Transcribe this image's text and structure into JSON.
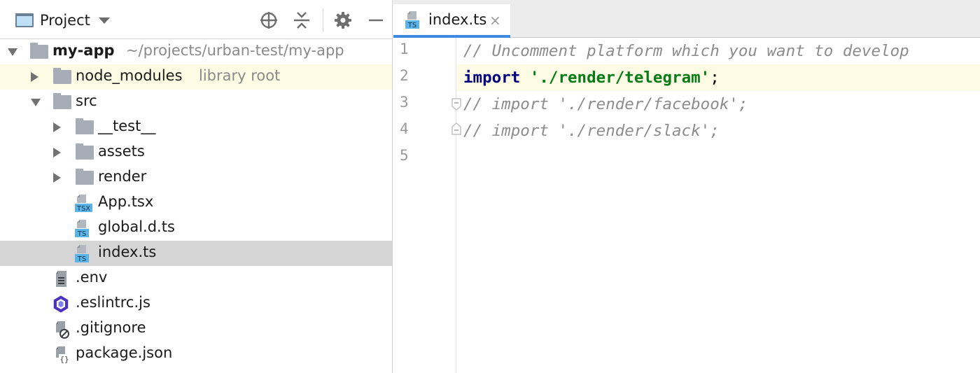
{
  "panel": {
    "title": "Project",
    "icons": [
      "project-view-icon",
      "dropdown-caret-icon",
      "locate-file-icon",
      "collapse-all-icon",
      "gear-icon",
      "minimize-icon"
    ]
  },
  "tree": [
    {
      "label": "my-app",
      "hint": "~/projects/urban-test/my-app",
      "kind": "folder",
      "state": "expanded",
      "bold": true
    },
    {
      "label": "node_modules",
      "hint": "library root",
      "kind": "folder",
      "state": "collapsed",
      "highlighted": true
    },
    {
      "label": "src",
      "kind": "folder",
      "state": "expanded"
    },
    {
      "label": "__test__",
      "kind": "folder",
      "state": "collapsed"
    },
    {
      "label": "assets",
      "kind": "folder",
      "state": "collapsed"
    },
    {
      "label": "render",
      "kind": "folder",
      "state": "collapsed"
    },
    {
      "label": "App.tsx",
      "kind": "file",
      "badge": "TSX"
    },
    {
      "label": "global.d.ts",
      "kind": "file",
      "badge": "TS"
    },
    {
      "label": "index.ts",
      "kind": "file",
      "badge": "TS",
      "selected": true
    },
    {
      "label": ".env",
      "kind": "file",
      "icon": "text-file-icon"
    },
    {
      "label": ".eslintrc.js",
      "kind": "file",
      "icon": "eslint-icon"
    },
    {
      "label": ".gitignore",
      "kind": "file",
      "icon": "ignore-file-icon"
    },
    {
      "label": "package.json",
      "kind": "file",
      "icon": "json-file-icon"
    }
  ],
  "editor": {
    "tab": {
      "label": "index.ts",
      "badge": "TS",
      "close": "×"
    },
    "line_numbers": [
      "1",
      "2",
      "3",
      "4",
      "5"
    ],
    "lines": [
      {
        "comment": "// Uncomment platform which you want to develop"
      },
      {
        "keyword": "import",
        "space": " ",
        "string": "'./render/telegram'",
        "punct": ";"
      },
      {
        "comment": "// import './render/facebook';"
      },
      {
        "comment": "// import './render/slack';"
      },
      {
        "comment": ""
      }
    ]
  },
  "colors": {
    "selection": "#d5d5d5",
    "current_line": "#fdfbe3",
    "tab_underline": "#3d8ae0",
    "keyword": "#000080",
    "string": "#067d17",
    "comment": "#8c8c8c",
    "ts_badge": "#5ab4e8"
  }
}
